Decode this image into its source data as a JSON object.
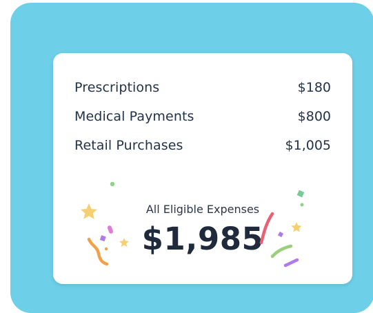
{
  "colors": {
    "outer_background": "#6dd0e8",
    "card_background": "#ffffff",
    "text_primary": "#22324a"
  },
  "summary": {
    "items": [
      {
        "label": "Prescriptions",
        "amount": "$180"
      },
      {
        "label": "Medical Payments",
        "amount": "$800"
      },
      {
        "label": "Retail Purchases",
        "amount": "$1,005"
      }
    ],
    "total_label": "All Eligible Expenses",
    "total_amount": "$1,985"
  },
  "icons": {
    "left_confetti": "confetti-left-icon",
    "right_confetti": "confetti-right-icon"
  }
}
